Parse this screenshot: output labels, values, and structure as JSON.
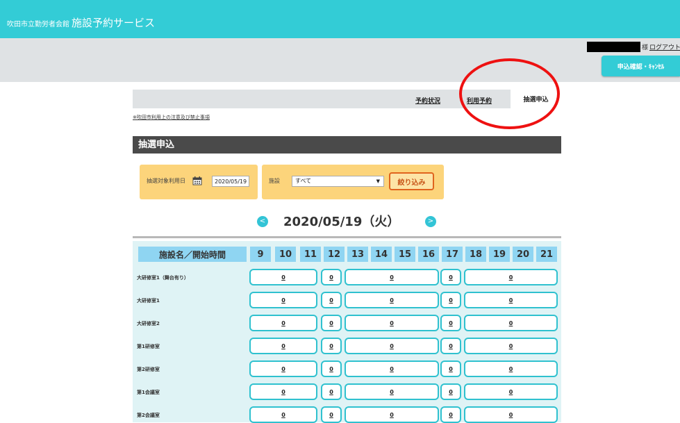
{
  "header": {
    "org_name": "吹田市立勤労者会館",
    "service_title": "施設予約サービス"
  },
  "userbar": {
    "user_suffix": "様",
    "logout_label": "ログアウト",
    "confirm_button_label": "申込確認・ｷｬﾝｾﾙ"
  },
  "tabs": {
    "status": "予約状況",
    "reserve": "利用予約",
    "lottery": "抽選申込"
  },
  "notice_link": "※吹田市利用上の注意及び禁止事項",
  "section_title": "抽選申込",
  "filter": {
    "date_label": "抽選対象利用日",
    "date_value": "2020/05/19",
    "facility_label": "施設",
    "facility_value": "すべて",
    "submit_label": "絞り込み"
  },
  "date_nav": {
    "prev": "<",
    "next": ">",
    "title": "2020/05/19（火）"
  },
  "table": {
    "name_header": "施設名／開始時間",
    "hours": [
      "9",
      "10",
      "11",
      "12",
      "13",
      "14",
      "15",
      "16",
      "17",
      "18",
      "19",
      "20",
      "21"
    ],
    "rows": [
      {
        "name": "大研修室1（舞台有り）",
        "slots": [
          "0",
          "0",
          "0",
          "0",
          "0"
        ]
      },
      {
        "name": "大研修室1",
        "slots": [
          "0",
          "0",
          "0",
          "0",
          "0"
        ]
      },
      {
        "name": "大研修室2",
        "slots": [
          "0",
          "0",
          "0",
          "0",
          "0"
        ]
      },
      {
        "name": "第1研修室",
        "slots": [
          "0",
          "0",
          "0",
          "0",
          "0"
        ]
      },
      {
        "name": "第2研修室",
        "slots": [
          "0",
          "0",
          "0",
          "0",
          "0"
        ]
      },
      {
        "name": "第1会議室",
        "slots": [
          "0",
          "0",
          "0",
          "0",
          "0"
        ]
      },
      {
        "name": "第2会議室",
        "slots": [
          "0",
          "0",
          "0",
          "0",
          "0"
        ]
      }
    ]
  },
  "colors": {
    "brand": "#33ccd6",
    "filter_bg": "#fcd47b",
    "filter_button_border": "#e0641e",
    "header_cell": "#8fd5f2",
    "annotation": "#ee1111"
  }
}
